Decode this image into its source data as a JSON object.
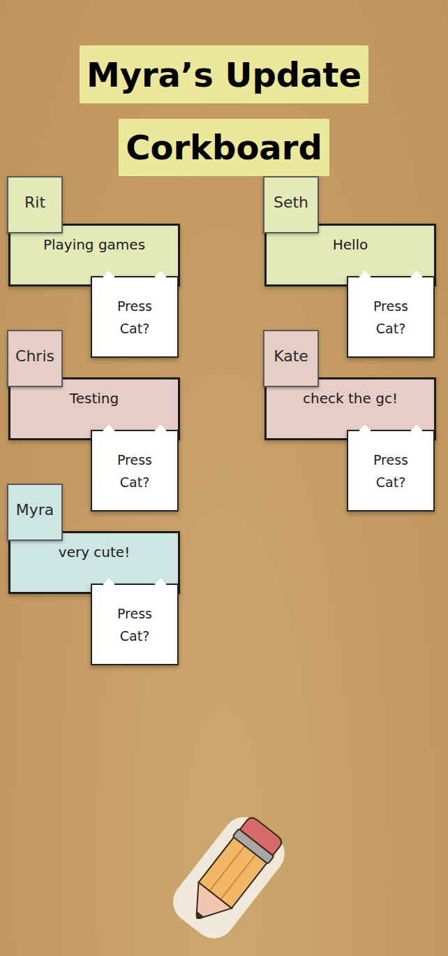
{
  "title": {
    "line1": "Myra’s Update",
    "line2": "Corkboard"
  },
  "cards": [
    {
      "name": "Rit",
      "message": "Playing games",
      "button": "Press Cat?",
      "color": "#e3e9b9"
    },
    {
      "name": "Seth",
      "message": "Hello",
      "button": "Press Cat?",
      "color": "#e3e9b9"
    },
    {
      "name": "Chris",
      "message": "Testing",
      "button": "Press Cat?",
      "color": "#e6cdc8"
    },
    {
      "name": "Kate",
      "message": "check the gc!",
      "button": "Press Cat?",
      "color": "#e6cdc8"
    },
    {
      "name": "Myra",
      "message": "very cute!",
      "button": "Press Cat?",
      "color": "#cde6e2"
    }
  ]
}
